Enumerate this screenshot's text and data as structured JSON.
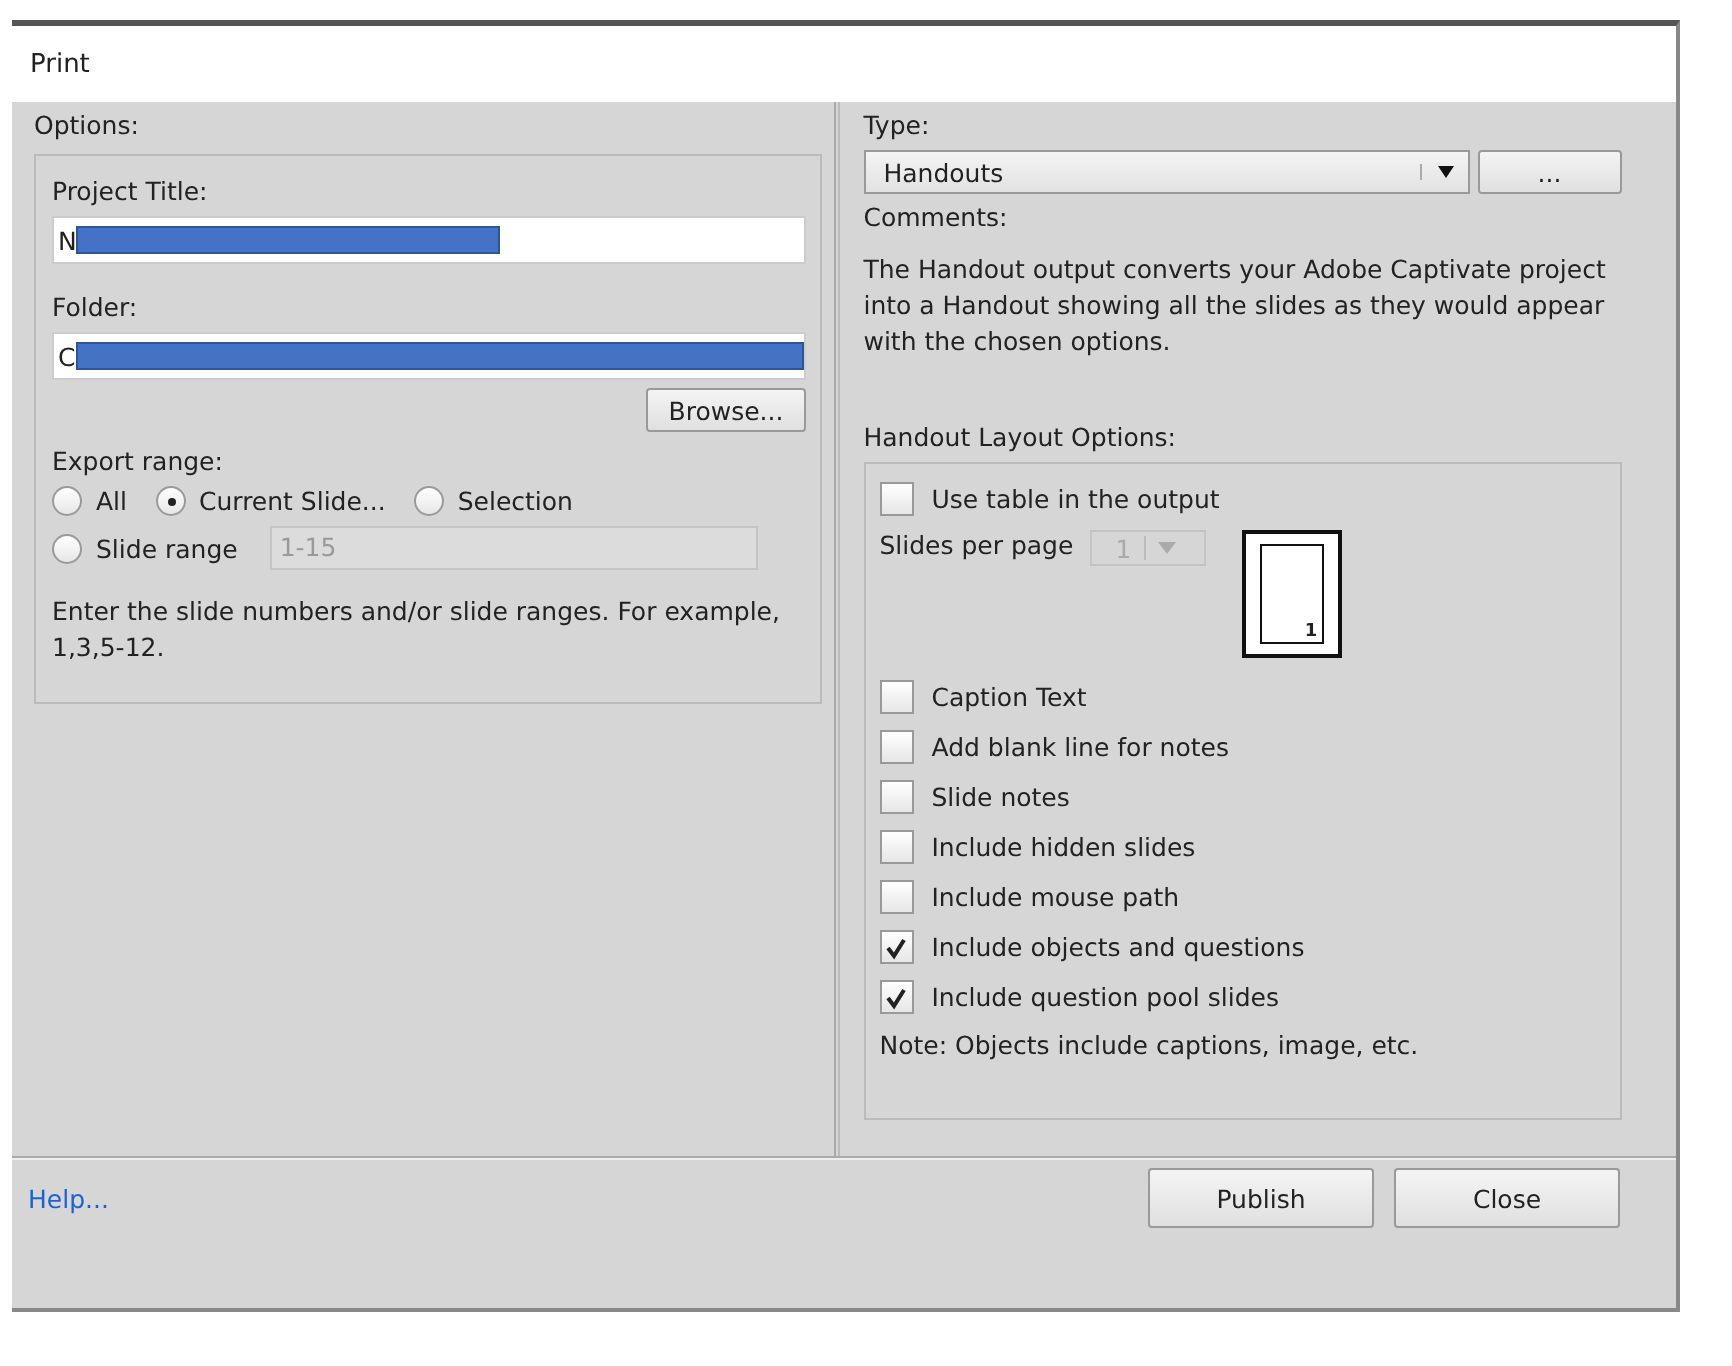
{
  "window": {
    "title": "Print"
  },
  "options": {
    "label": "Options:",
    "project_title": {
      "label": "Project Title:",
      "value": "N"
    },
    "folder": {
      "label": "Folder:",
      "value": "C"
    },
    "browse_button": "Browse...",
    "export_range": {
      "label": "Export range:",
      "radios": [
        {
          "label": "All",
          "selected": false
        },
        {
          "label": "Current Slide...",
          "selected": true
        },
        {
          "label": "Selection",
          "selected": false
        },
        {
          "label": "Slide range",
          "selected": false
        }
      ],
      "slide_range": {
        "value": "1-15",
        "disabled": true
      }
    },
    "hint": "Enter the slide numbers and/or slide ranges. For example, 1,3,5-12."
  },
  "type": {
    "label": "Type:",
    "value": "Handouts",
    "more_button": "...",
    "comments_label": "Comments:",
    "comments": "The Handout output converts your Adobe Captivate project into a Handout showing all the slides as they would appear with the chosen options."
  },
  "layout": {
    "label": "Handout Layout Options:",
    "use_table": {
      "label": "Use table in the output",
      "checked": false
    },
    "slides_per_page": {
      "label": "Slides per page",
      "value": "1",
      "disabled": true
    },
    "preview_page_number": "1",
    "checkboxes": [
      {
        "label": "Caption Text",
        "checked": false
      },
      {
        "label": "Add blank line for notes",
        "checked": false
      },
      {
        "label": "Slide notes",
        "checked": false
      },
      {
        "label": "Include hidden slides",
        "checked": false
      },
      {
        "label": "Include mouse path",
        "checked": false
      },
      {
        "label": "Include objects and questions",
        "checked": true
      },
      {
        "label": "Include question pool slides",
        "checked": true
      }
    ],
    "note": "Note: Objects include captions, image, etc."
  },
  "footer": {
    "help": "Help...",
    "buttons": [
      "Publish",
      "Close"
    ]
  }
}
